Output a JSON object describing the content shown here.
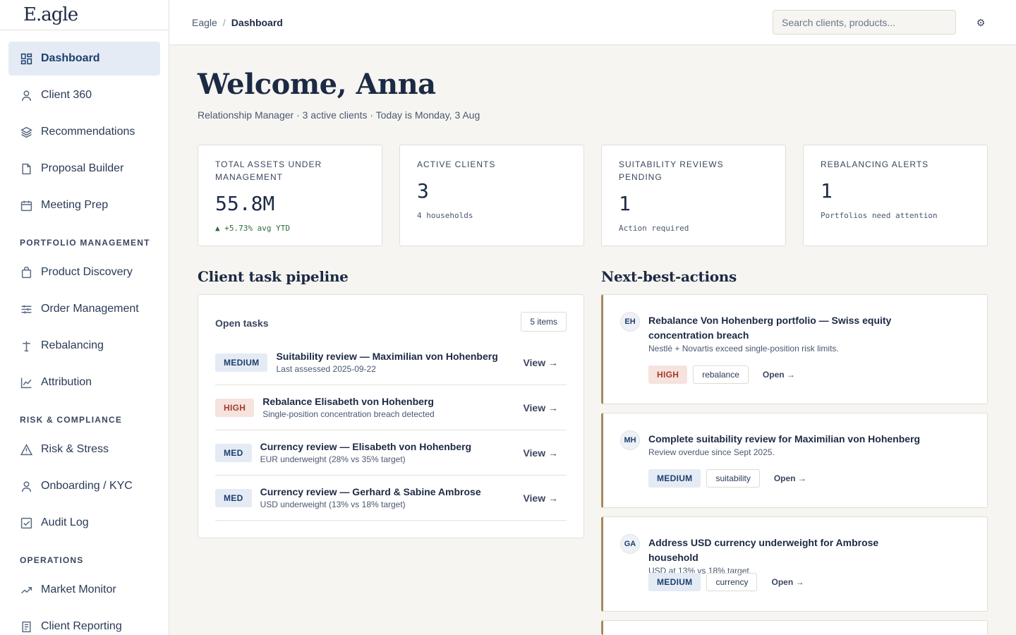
{
  "app": {
    "logo": "E.agle"
  },
  "sidebar": {
    "items": [
      {
        "label": "Dashboard",
        "icon": "grid-icon",
        "active": true
      },
      {
        "label": "Client 360",
        "icon": "user-icon"
      },
      {
        "label": "Recommendations",
        "icon": "layers-icon"
      },
      {
        "label": "Proposal Builder",
        "icon": "document-icon"
      },
      {
        "label": "Meeting Prep",
        "icon": "calendar-icon"
      }
    ],
    "sections": [
      {
        "title": "PORTFOLIO MANAGEMENT",
        "items": [
          {
            "label": "Product Discovery",
            "icon": "bag-icon"
          },
          {
            "label": "Order Management",
            "icon": "sliders-icon"
          },
          {
            "label": "Rebalancing",
            "icon": "scale-icon"
          },
          {
            "label": "Attribution",
            "icon": "line-chart-icon"
          }
        ]
      },
      {
        "title": "RISK & COMPLIANCE",
        "items": [
          {
            "label": "Risk & Stress",
            "icon": "warning-icon"
          },
          {
            "label": "Onboarding / KYC",
            "icon": "user-check-icon"
          },
          {
            "label": "Audit Log",
            "icon": "checkbox-icon"
          }
        ]
      },
      {
        "title": "OPERATIONS",
        "items": [
          {
            "label": "Market Monitor",
            "icon": "trend-icon"
          },
          {
            "label": "Client Reporting",
            "icon": "report-icon"
          }
        ]
      }
    ]
  },
  "header": {
    "breadcrumb": {
      "root": "Eagle",
      "separator": "/",
      "current": "Dashboard"
    },
    "search_placeholder": "Search clients, products...",
    "settings_icon": "gear-icon"
  },
  "main": {
    "welcome": "Welcome, Anna",
    "subtitle": "Relationship Manager · 3 active clients · Today is Monday, 3 Aug",
    "kpis": [
      {
        "label": "TOTAL ASSETS UNDER MANAGEMENT",
        "value": "55.8M",
        "note": "▲ +5.73% avg YTD"
      },
      {
        "label": "ACTIVE CLIENTS",
        "value": "3",
        "note": "4 households"
      },
      {
        "label": "SUITABILITY REVIEWS PENDING",
        "value": "1",
        "note": "Action required"
      },
      {
        "label": "REBALANCING ALERTS",
        "value": "1",
        "note": "Portfolios need attention"
      }
    ],
    "pipeline": {
      "title": "Client task pipeline",
      "head": "Open tasks",
      "count": "5 items",
      "tasks": [
        {
          "priority": "MEDIUM",
          "title": "Suitability review — Maximilian von Hohenberg",
          "sub": "Last assessed 2025-09-22",
          "action": "View →"
        },
        {
          "priority": "HIGH",
          "title": "Rebalance Elisabeth von Hohenberg",
          "sub": "Single-position concentration breach detected",
          "action": "View →"
        },
        {
          "priority": "MED",
          "title": "Currency review — Elisabeth von Hohenberg",
          "sub": "EUR underweight (28% vs 35% target)",
          "action": "View →"
        },
        {
          "priority": "MED",
          "title": "Currency review — Gerhard & Sabine Ambrose",
          "sub": "USD underweight (13% vs 18% target)",
          "action": "View →"
        }
      ]
    },
    "nba": {
      "title": "Next-best-actions",
      "cards": [
        {
          "initials": "EH",
          "title": "Rebalance Von Hohenberg portfolio — Swiss equity concentration breach",
          "sub": "Nestlé + Novartis exceed single-position risk limits.",
          "priority": "HIGH",
          "tag": "rebalance",
          "action": "Open →"
        },
        {
          "initials": "MH",
          "title": "Complete suitability review for Maximilian von Hohenberg",
          "sub": "Review overdue since Sept 2025.",
          "priority": "MEDIUM",
          "tag": "suitability",
          "action": "Open →"
        },
        {
          "initials": "GA",
          "title": "Address USD currency underweight for Ambrose household",
          "sub": "USD at 13% vs 18% target.",
          "priority": "MEDIUM",
          "tag": "currency",
          "action": "Open →"
        }
      ]
    }
  },
  "colors": {
    "accent": "#1d3e6e",
    "card_border_accent": "#a48a5c",
    "high": "#a53a2a",
    "positive": "#2f6b3a"
  }
}
